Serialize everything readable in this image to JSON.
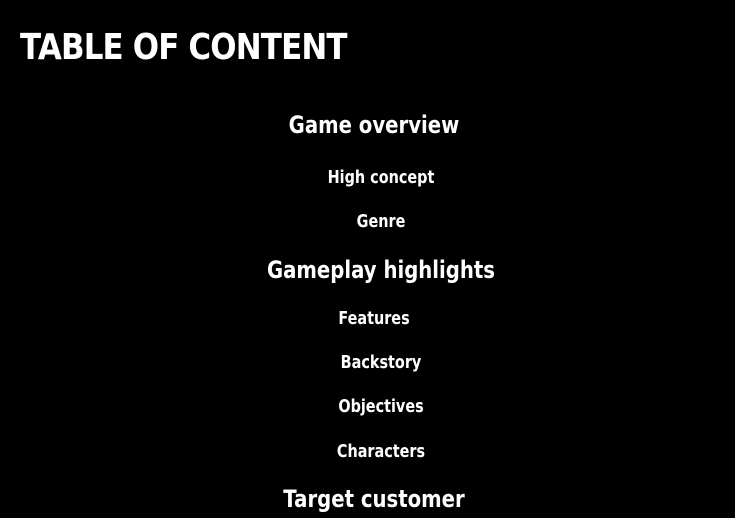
{
  "slide": {
    "title": "TABLE OF CONTENT",
    "background_color": "#000000",
    "text_color": "#ffffff",
    "items": [
      {
        "label": "Game overview",
        "level": 1
      },
      {
        "label": "High concept",
        "level": 2
      },
      {
        "label": "Genre",
        "level": 2
      },
      {
        "label": "Gameplay highlights",
        "level": 1
      },
      {
        "label": "Features",
        "level": 2
      },
      {
        "label": "Backstory",
        "level": 2
      },
      {
        "label": "Objectives",
        "level": 2
      },
      {
        "label": "Characters",
        "level": 2
      },
      {
        "label": "Target customer",
        "level": 1
      }
    ]
  }
}
